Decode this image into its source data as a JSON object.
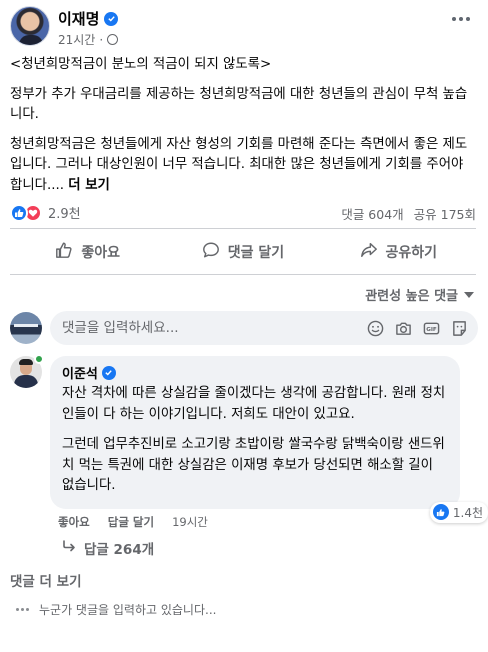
{
  "post": {
    "author": "이재명",
    "time": "21시간",
    "paragraphs": [
      "<청년희망적금이 분노의 적금이 되지 않도록>",
      "정부가 추가 우대금리를 제공하는 청년희망적금에 대한 청년들의 관심이 무척 높습니다.",
      "청년희망적금은 청년들에게 자산 형성의 기회를 마련해 준다는 측면에서 좋은 제도입니다. 그러나 대상인원이 너무 적습니다. 최대한 많은 청년들에게 기회를 주어야 합니다...."
    ],
    "see_more": "더 보기"
  },
  "stats": {
    "reactions": "2.9천",
    "comments": "댓글 604개",
    "shares": "공유 175회"
  },
  "actions": {
    "like": "좋아요",
    "comment": "댓글 달기",
    "share": "공유하기"
  },
  "sort_label": "관련성 높은 댓글",
  "compose": {
    "placeholder": "댓글을 입력하세요..."
  },
  "comment": {
    "author": "이준석",
    "paragraphs": [
      "자산 격차에 따른 상실감을 줄이겠다는 생각에 공감합니다. 원래 정치인들이 다 하는 이야기입니다. 저희도 대안이 있고요.",
      "그런데 업무추진비로 소고기랑 초밥이랑 쌀국수랑 닭백숙이랑 샌드위치 먹는 특권에 대한 상실감은 이재명 후보가 당선되면 해소할 길이 없습니다."
    ],
    "reactions": "1.4천",
    "like": "좋아요",
    "reply": "답글 달기",
    "time": "19시간",
    "replies": "답글 264개"
  },
  "more_comments": "댓글 더 보기",
  "typing": "누군가 댓글을 입력하고 있습니다...",
  "colors": {
    "accent": "#1877f2",
    "love": "#f33e58",
    "muted": "#65676b",
    "bubble": "#f0f2f5"
  }
}
